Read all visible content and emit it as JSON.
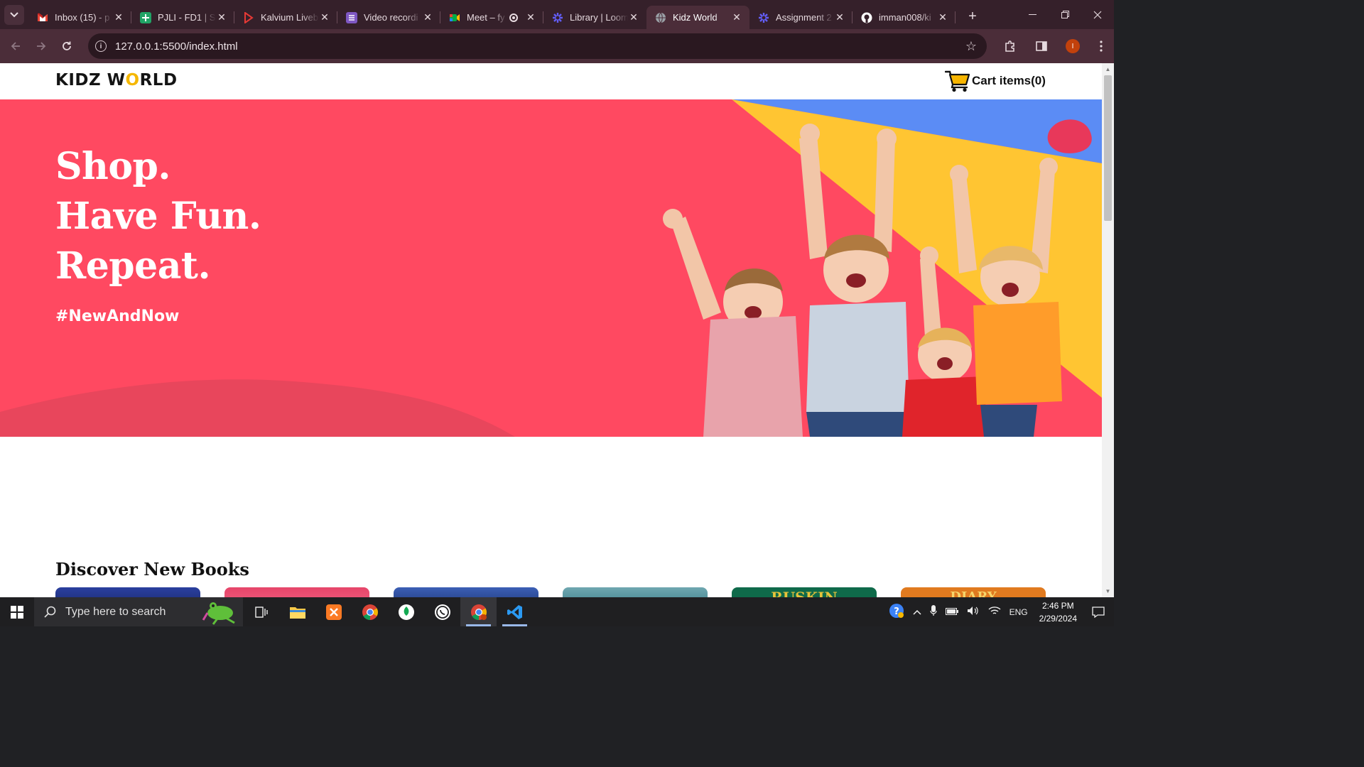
{
  "browser": {
    "tabs": [
      {
        "title": "Inbox (15) - p",
        "icon": "gmail-icon",
        "color": "#ea4335"
      },
      {
        "title": "PJLI - FD1 | Sc",
        "icon": "sheets-icon",
        "color": "#21a366"
      },
      {
        "title": "Kalvium Liveb",
        "icon": "kalvium-icon",
        "color": "#e53935"
      },
      {
        "title": "Video recordi",
        "icon": "forms-icon",
        "color": "#7e57c2"
      },
      {
        "title": "Meet – fy",
        "icon": "meet-icon",
        "color": "#00897b",
        "recording": true
      },
      {
        "title": "Library | Loom",
        "icon": "loom-icon",
        "color": "#625df5"
      },
      {
        "title": "Kidz World",
        "icon": "globe-icon",
        "color": "#9aa0a6",
        "active": true
      },
      {
        "title": "Assignment 2",
        "icon": "loom-icon",
        "color": "#625df5"
      },
      {
        "title": "imman008/ki",
        "icon": "github-icon",
        "color": "#ffffff"
      }
    ],
    "url": "127.0.0.1:5500/index.html",
    "profile_initial": "I"
  },
  "site": {
    "logo_prefix": "KIDZ W",
    "logo_o": "O",
    "logo_suffix": "RLD",
    "cart_label": "Cart items(0)",
    "hero": {
      "line1": "Shop.",
      "line2": "Have Fun.",
      "line3": "Repeat.",
      "hashtag": "#NewAndNow",
      "bg_color": "#ff4961"
    },
    "section_title": "Discover New Books",
    "book_partial_texts": [
      "",
      "",
      "",
      "",
      "RUSKIN",
      "DIARY"
    ]
  },
  "taskbar": {
    "search_placeholder": "Type here to search",
    "language": "ENG",
    "time": "2:46 PM",
    "date": "2/29/2024"
  }
}
